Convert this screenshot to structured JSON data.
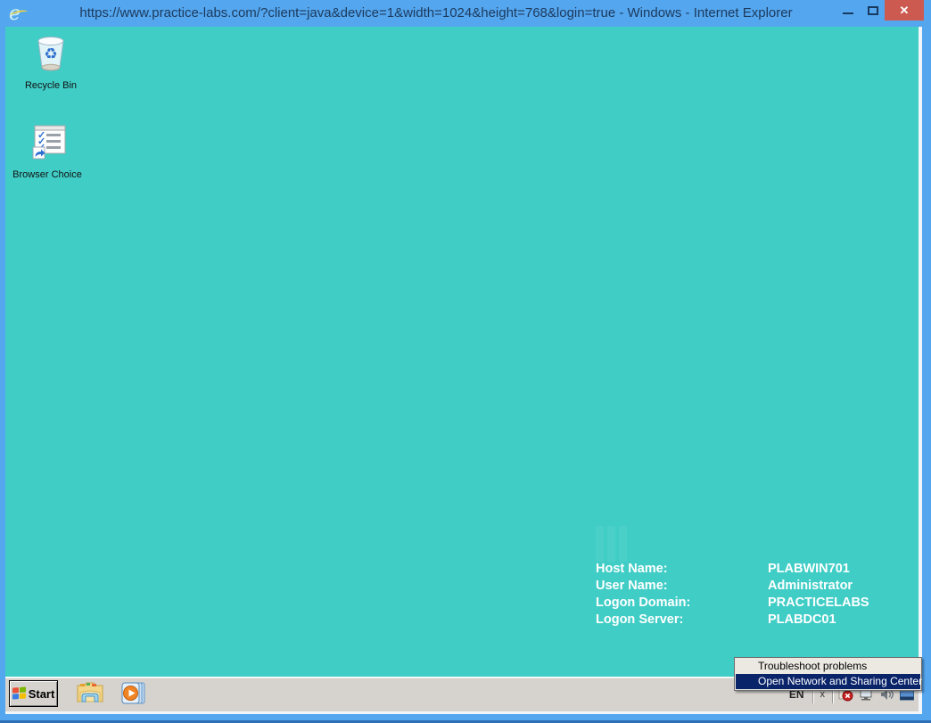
{
  "window": {
    "title": "https://www.practice-labs.com/?client=java&device=1&width=1024&height=768&login=true - Windows  - Internet Explorer",
    "close_glyph": "✕"
  },
  "desktop": {
    "icons": [
      {
        "label": "Recycle Bin"
      },
      {
        "label": "Browser Choice"
      }
    ],
    "bginfo": {
      "rows": [
        {
          "label": "Host Name:",
          "value": "PLABWIN701"
        },
        {
          "label": "User Name:",
          "value": "Administrator"
        },
        {
          "label": "Logon Domain:",
          "value": "PRACTICELABS"
        },
        {
          "label": "Logon Server:",
          "value": "PLABDC01"
        }
      ]
    }
  },
  "context_menu": {
    "items": [
      {
        "label": "Troubleshoot problems",
        "selected": false
      },
      {
        "label": "Open Network and Sharing Center",
        "selected": true
      }
    ]
  },
  "taskbar": {
    "start_label": "Start",
    "tray": {
      "language": "EN",
      "hide_glyph": "x"
    }
  },
  "colors": {
    "desktop_teal": "#40cdc6",
    "titlebar_blue": "#54a6ef",
    "close_red": "#cd5a51",
    "menu_highlight_blue": "#0a246a",
    "taskbar_gray": "#d6d3ce",
    "bginfo_text": "#ffffff"
  }
}
